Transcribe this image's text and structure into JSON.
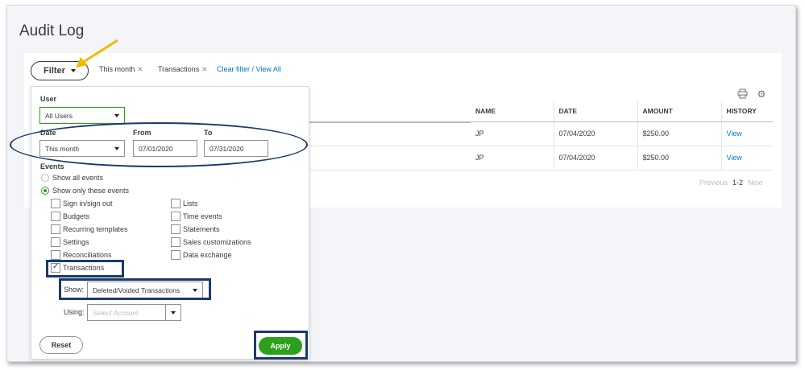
{
  "page": {
    "title": "Audit Log"
  },
  "filter_bar": {
    "filter_label": "Filter",
    "chips": [
      "This month",
      "Transactions"
    ],
    "clear_link": "Clear filter / View All"
  },
  "table": {
    "headers": [
      "NAME",
      "DATE",
      "AMOUNT",
      "HISTORY"
    ],
    "rows": [
      {
        "name": "JP",
        "date": "07/04/2020",
        "amount": "$250.00",
        "history": "View"
      },
      {
        "name": "JP",
        "date": "07/04/2020",
        "amount": "$250.00",
        "history": "View"
      }
    ]
  },
  "pager": {
    "previous": "Previous",
    "range": "1-2",
    "next": "Next"
  },
  "icons": {
    "print": "print-icon",
    "settings": "gear-icon"
  },
  "filter_panel": {
    "user_label": "User",
    "user_value": "All Users",
    "date_label": "Date",
    "date_value": "This month",
    "from_label": "From",
    "from_value": "07/01/2020",
    "to_label": "To",
    "to_value": "07/31/2020",
    "events_label": "Events",
    "radio_all": "Show all events",
    "radio_only": "Show only these events",
    "events_left": [
      {
        "label": "Sign in/sign out",
        "checked": false
      },
      {
        "label": "Budgets",
        "checked": false
      },
      {
        "label": "Recurring templates",
        "checked": false
      },
      {
        "label": "Settings",
        "checked": false
      },
      {
        "label": "Reconciliations",
        "checked": false
      },
      {
        "label": "Transactions",
        "checked": true
      }
    ],
    "events_right": [
      {
        "label": "Lists",
        "checked": false
      },
      {
        "label": "Time events",
        "checked": false
      },
      {
        "label": "Statements",
        "checked": false
      },
      {
        "label": "Sales customizations",
        "checked": false
      },
      {
        "label": "Data exchange",
        "checked": false
      }
    ],
    "show_label": "Show:",
    "show_value": "Deleted/Voided Transactions",
    "using_label": "Using:",
    "using_placeholder": "Select Account",
    "reset_label": "Reset",
    "apply_label": "Apply"
  },
  "colors": {
    "accent_green": "#2ca01c",
    "link_blue": "#0077c5",
    "annotation_navy": "#1b3a6b",
    "annotation_arrow": "#f5b800"
  }
}
